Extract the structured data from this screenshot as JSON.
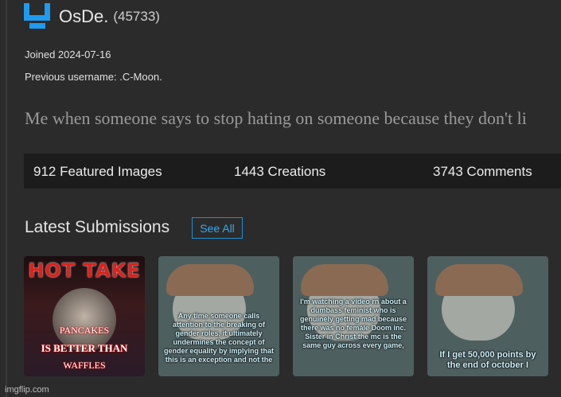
{
  "profile": {
    "username": "OsDe.",
    "user_id": "(45733)",
    "joined": "Joined 2024-07-16",
    "previous_username": "Previous username: .C-Moon.",
    "bio": "Me when someone says to stop hating on someone because they don't li"
  },
  "stats": {
    "featured": "912 Featured Images",
    "creations": "1443 Creations",
    "comments": "3743 Comments"
  },
  "submissions": {
    "title": "Latest Submissions",
    "see_all": "See All",
    "items": [
      {
        "title": "HOT TAKE",
        "lines": [
          "PANCAKES",
          "IS BETTER THAN",
          "WAFFLES"
        ]
      },
      {
        "text": "Any time someone calls attention to the breaking of gender roles, it ultimately undermines the concept of gender equality by implying that this is an exception and not the"
      },
      {
        "text": "I'm watching a video rn about a dumbass feminist who is genuinely getting mad because there was no female Doom inc. Sister in Christ the mc is the same guy across every game,"
      },
      {
        "text": "If I get 50,000 points by the end of october I"
      }
    ]
  },
  "footer": {
    "watermark": "imgflip.com"
  },
  "colors": {
    "accent": "#1d9bf0",
    "background": "#2b2b2b",
    "stats_bar": "#1c1c1c"
  }
}
